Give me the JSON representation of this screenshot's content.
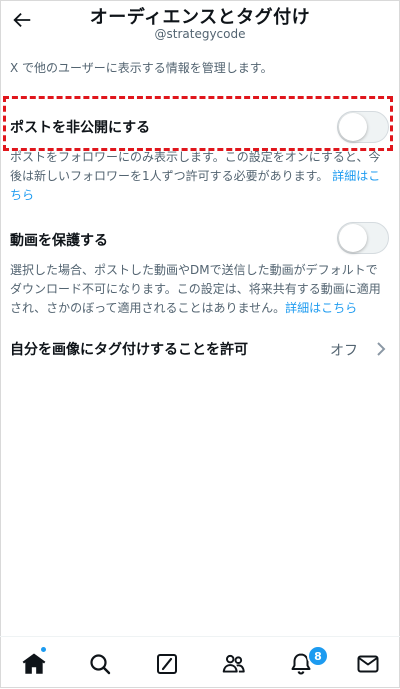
{
  "header": {
    "title": "オーディエンスとタグ付け",
    "username": "@strategycode",
    "back_icon": "arrow-left-icon"
  },
  "intro": "X で他のユーザーに表示する情報を管理します。",
  "protect_posts": {
    "label": "ポストを非公開にする",
    "enabled": false,
    "help_line1": "ポストをフォロワーにのみ表示します。この設定をオンにすると、今",
    "help_line2": "後は新しいフォロワーを1人ずつ許可する必要があります。",
    "learn_more_1": "詳細はこ",
    "learn_more_2": "ちら",
    "highlight_color": "#e0161c"
  },
  "protect_videos": {
    "label": "動画を保護する",
    "enabled": false,
    "help_line1": "選択した場合、ポストした動画やDMで送信した動画がデフォルトで",
    "help_line2": "ダウンロード不可になります。この設定は、将来共有する動画に適用",
    "help_line3": "され、さかのぼって適用されることはありません。",
    "learn_more": "詳細はこちら"
  },
  "photo_tagging": {
    "label": "自分を画像にタグ付けすることを許可",
    "value": "オフ",
    "chevron_icon": "chevron-right-icon"
  },
  "bottom_nav": {
    "items": [
      {
        "name": "home",
        "icon": "home-icon",
        "active": true
      },
      {
        "name": "search",
        "icon": "search-icon"
      },
      {
        "name": "grok",
        "icon": "grok-icon"
      },
      {
        "name": "communities",
        "icon": "communities-icon"
      },
      {
        "name": "notifications",
        "icon": "bell-icon",
        "badge": "8"
      },
      {
        "name": "messages",
        "icon": "mail-icon"
      }
    ]
  },
  "colors": {
    "accent": "#1d9bf0",
    "text": "#0f1419",
    "secondary": "#536471"
  }
}
